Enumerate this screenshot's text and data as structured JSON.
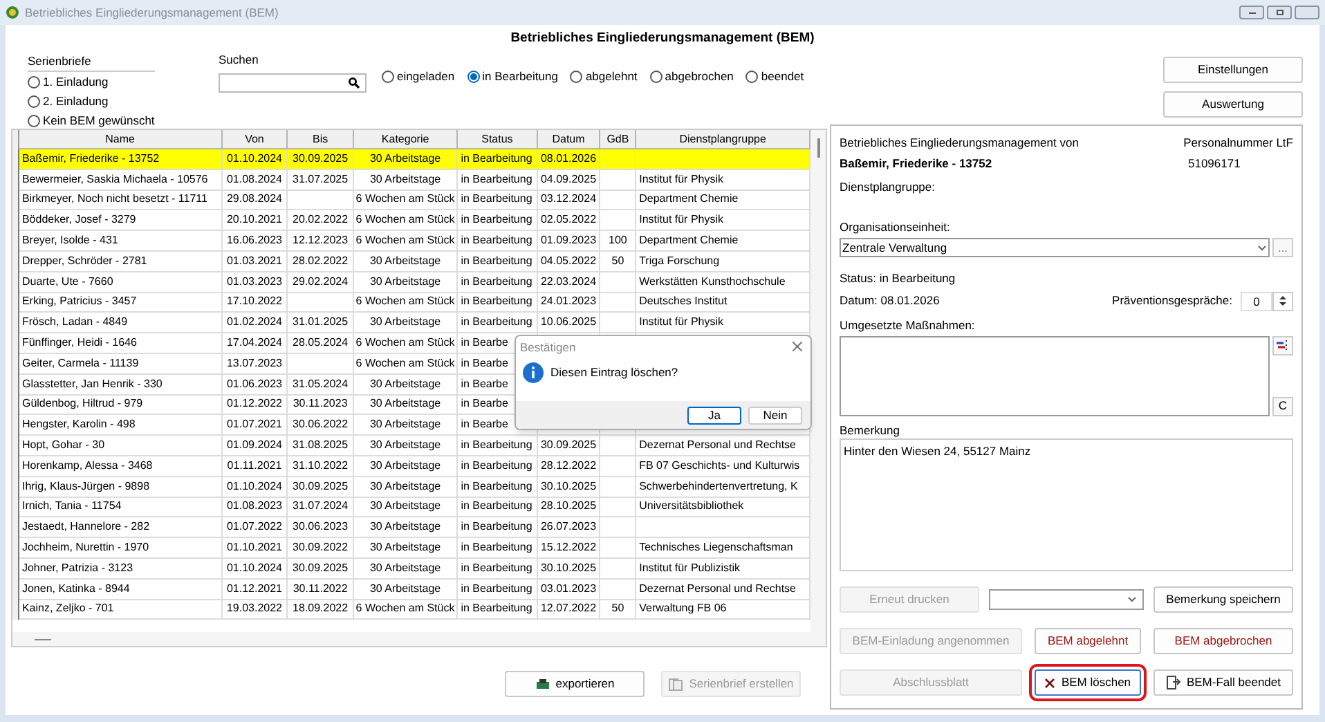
{
  "window": {
    "title": "Betriebliches Eingliederungsmanagement (BEM)"
  },
  "heading": "Betriebliches Eingliederungsmanagement (BEM)",
  "serienbriefe": {
    "label": "Serienbriefe",
    "options": [
      {
        "label": "1. Einladung",
        "selected": false
      },
      {
        "label": "2. Einladung",
        "selected": false
      },
      {
        "label": "Kein BEM gewünscht",
        "selected": false
      }
    ]
  },
  "search": {
    "label": "Suchen"
  },
  "status_filter": [
    {
      "label": "eingeladen",
      "selected": false
    },
    {
      "label": "in Bearbeitung",
      "selected": true
    },
    {
      "label": "abgelehnt",
      "selected": false
    },
    {
      "label": "abgebrochen",
      "selected": false
    },
    {
      "label": "beendet",
      "selected": false
    }
  ],
  "top_buttons": [
    "Einstellungen",
    "Auswertung"
  ],
  "table": {
    "columns": [
      "Name",
      "Von",
      "Bis",
      "Kategorie",
      "Status",
      "Datum",
      "GdB",
      "Dienstplangruppe"
    ],
    "rows": [
      {
        "selected": true,
        "cells": [
          "Baßemir, Friederike - 13752",
          "01.10.2024",
          "30.09.2025",
          "30 Arbeitstage",
          "in Bearbeitung",
          "08.01.2026",
          "",
          ""
        ]
      },
      {
        "selected": false,
        "cells": [
          "Bewermeier, Saskia Michaela - 10576",
          "01.08.2024",
          "31.07.2025",
          "30 Arbeitstage",
          "in Bearbeitung",
          "04.09.2025",
          "",
          "Institut für Physik"
        ]
      },
      {
        "selected": false,
        "cells": [
          "Birkmeyer, Noch nicht besetzt - 11711",
          "29.08.2024",
          "",
          "6 Wochen am Stück",
          "in Bearbeitung",
          "03.12.2024",
          "",
          "Department Chemie"
        ]
      },
      {
        "selected": false,
        "cells": [
          "Böddeker, Josef - 3279",
          "20.10.2021",
          "20.02.2022",
          "6 Wochen am Stück",
          "in Bearbeitung",
          "02.05.2022",
          "",
          "Institut für Physik"
        ]
      },
      {
        "selected": false,
        "cells": [
          "Breyer, Isolde - 431",
          "16.06.2023",
          "12.12.2023",
          "6 Wochen am Stück",
          "in Bearbeitung",
          "01.09.2023",
          "100",
          "Department Chemie"
        ]
      },
      {
        "selected": false,
        "cells": [
          "Drepper, Schröder - 2781",
          "01.03.2021",
          "28.02.2022",
          "30 Arbeitstage",
          "in Bearbeitung",
          "04.05.2022",
          "50",
          "Triga Forschung"
        ]
      },
      {
        "selected": false,
        "cells": [
          "Duarte, Ute - 7660",
          "01.03.2023",
          "29.02.2024",
          "30 Arbeitstage",
          "in Bearbeitung",
          "22.03.2024",
          "",
          "Werkstätten Kunsthochschule"
        ]
      },
      {
        "selected": false,
        "cells": [
          "Erking, Patricius - 3457",
          "17.10.2022",
          "",
          "6 Wochen am Stück",
          "in Bearbeitung",
          "24.01.2023",
          "",
          "Deutsches Institut"
        ]
      },
      {
        "selected": false,
        "cells": [
          "Frösch, Ladan - 4849",
          "01.02.2024",
          "31.01.2025",
          "30 Arbeitstage",
          "in Bearbeitung",
          "10.06.2025",
          "",
          "Institut für Physik"
        ]
      },
      {
        "selected": false,
        "cells": [
          "Fünffinger, Heidi - 1646",
          "17.04.2024",
          "28.05.2024",
          "6 Wochen am Stück",
          "in Bearbe",
          "",
          "",
          ""
        ]
      },
      {
        "selected": false,
        "cells": [
          "Geiter, Carmela - 11139",
          "13.07.2023",
          "",
          "6 Wochen am Stück",
          "in Bearbe",
          "",
          "",
          ""
        ]
      },
      {
        "selected": false,
        "cells": [
          "Glasstetter, Jan Henrik - 330",
          "01.06.2023",
          "31.05.2024",
          "30 Arbeitstage",
          "in Bearbe",
          "",
          "",
          ""
        ]
      },
      {
        "selected": false,
        "cells": [
          "Güldenbog, Hiltrud - 979",
          "01.12.2022",
          "30.11.2023",
          "30 Arbeitstage",
          "in Bearbe",
          "",
          "",
          ""
        ]
      },
      {
        "selected": false,
        "cells": [
          "Hengster, Karolin - 498",
          "01.07.2021",
          "30.06.2022",
          "30 Arbeitstage",
          "in Bearbe",
          "",
          "",
          ""
        ]
      },
      {
        "selected": false,
        "cells": [
          "Hopt, Gohar - 30",
          "01.09.2024",
          "31.08.2025",
          "30 Arbeitstage",
          "in Bearbeitung",
          "30.09.2025",
          "",
          "Dezernat Personal und Rechtse"
        ]
      },
      {
        "selected": false,
        "cells": [
          "Horenkamp, Alessa - 3468",
          "01.11.2021",
          "31.10.2022",
          "30 Arbeitstage",
          "in Bearbeitung",
          "28.12.2022",
          "",
          "FB 07 Geschichts- und Kulturwis"
        ]
      },
      {
        "selected": false,
        "cells": [
          "Ihrig, Klaus-Jürgen - 9898",
          "01.10.2024",
          "30.09.2025",
          "30 Arbeitstage",
          "in Bearbeitung",
          "30.10.2025",
          "",
          "Schwerbehindertenvertretung, K"
        ]
      },
      {
        "selected": false,
        "cells": [
          "Irnich, Tania - 11754",
          "01.08.2023",
          "31.07.2024",
          "30 Arbeitstage",
          "in Bearbeitung",
          "28.10.2025",
          "",
          "Universitätsbibliothek"
        ]
      },
      {
        "selected": false,
        "cells": [
          "Jestaedt, Hannelore - 282",
          "01.07.2022",
          "30.06.2023",
          "30 Arbeitstage",
          "in Bearbeitung",
          "26.07.2023",
          "",
          ""
        ]
      },
      {
        "selected": false,
        "cells": [
          "Jochheim, Nurettin - 1970",
          "01.10.2021",
          "30.09.2022",
          "30 Arbeitstage",
          "in Bearbeitung",
          "15.12.2022",
          "",
          "Technisches Liegenschaftsman"
        ]
      },
      {
        "selected": false,
        "cells": [
          "Johner, Patrizia - 3123",
          "01.10.2024",
          "30.09.2025",
          "30 Arbeitstage",
          "in Bearbeitung",
          "30.10.2025",
          "",
          "Institut für Publizistik"
        ]
      },
      {
        "selected": false,
        "cells": [
          "Jonen, Katinka - 8944",
          "01.12.2021",
          "30.11.2022",
          "30 Arbeitstage",
          "in Bearbeitung",
          "03.01.2023",
          "",
          "Dezernat Personal und Rechtse"
        ]
      },
      {
        "selected": false,
        "cells": [
          "Kainz, Zeljko - 701",
          "19.03.2022",
          "18.09.2022",
          "6 Wochen am Stück",
          "in Bearbeitung",
          "12.07.2022",
          "50",
          "Verwaltung FB 06"
        ]
      }
    ]
  },
  "left_buttons": [
    {
      "label": "exportieren",
      "kind": "export",
      "disabled": false
    },
    {
      "label": "Serienbrief erstellen",
      "kind": "letter",
      "disabled": true
    }
  ],
  "details": {
    "title": "Betriebliches Eingliederungsmanagement von",
    "name": "Baßemir, Friederike - 13752",
    "personnel_label": "Personalnummer LtF",
    "personnel_number": "51096171",
    "group_label": "Dienstplangruppe:",
    "org_label": "Organisationseinheit:",
    "org_value": "Zentrale Verwaltung",
    "org_button": "...",
    "status": "Status: in Bearbeitung",
    "date": "Datum: 08.01.2026",
    "prevention_label": "Präventionsgespräche:",
    "prevention_value": "0",
    "measures_label": "Umgesetzte Maßnahmen:",
    "measures_clear": "C",
    "remark_label": "Bemerkung",
    "remark_value": "Hinter den Wiesen 24, 55127 Mainz"
  },
  "action_rows": [
    [
      {
        "label": "Erneut drucken",
        "kind": "disabled"
      },
      {
        "kind": "dropdown"
      },
      {
        "label": "Bemerkung speichern",
        "kind": "normal"
      }
    ],
    [
      {
        "label": "BEM-Einladung angenommen",
        "kind": "disabled"
      },
      {
        "label": "BEM abgelehnt",
        "kind": "danger"
      },
      {
        "label": "BEM abgebrochen",
        "kind": "danger"
      }
    ],
    [
      {
        "label": "Abschlussblatt",
        "kind": "disabled"
      },
      {
        "label": "BEM löschen",
        "kind": "delete"
      },
      {
        "label": "BEM-Fall beendet",
        "kind": "finish"
      }
    ]
  ],
  "dialog": {
    "title": "Bestätigen",
    "message": "Diesen Eintrag löschen?",
    "buttons": [
      {
        "label": "Ja",
        "focused": true
      },
      {
        "label": "Nein",
        "focused": false
      }
    ]
  }
}
